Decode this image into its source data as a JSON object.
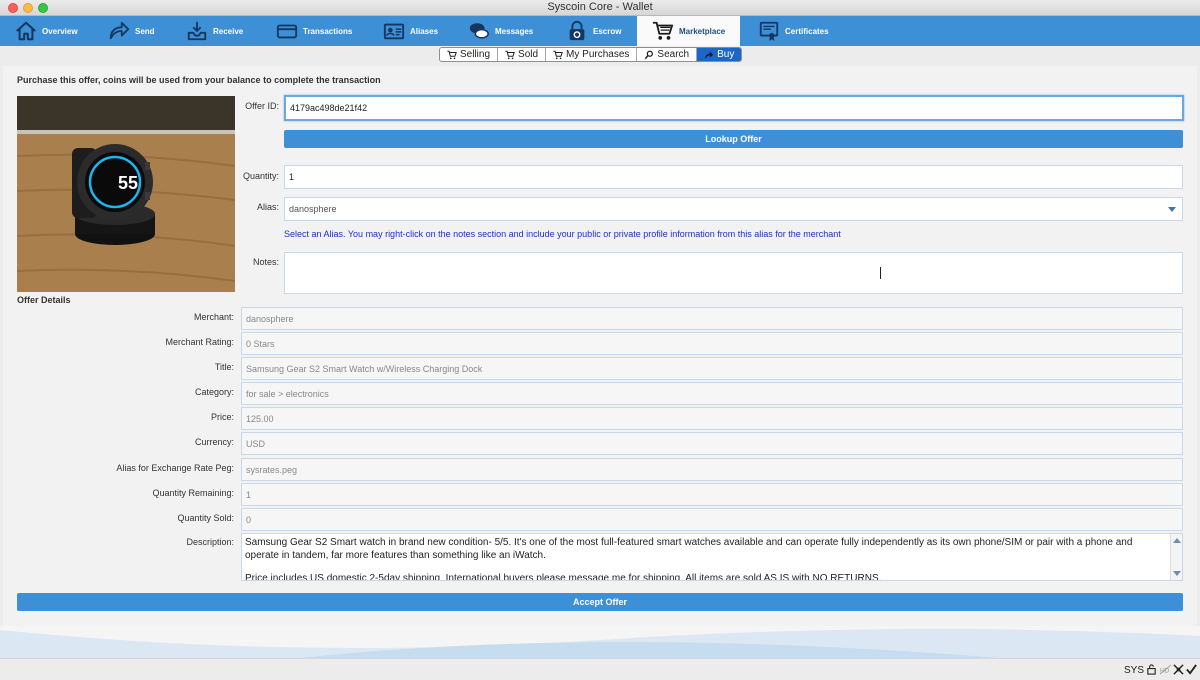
{
  "window": {
    "title": "Syscoin Core - Wallet"
  },
  "toolbar": {
    "items": [
      {
        "label": "Overview",
        "icon": "home-icon"
      },
      {
        "label": "Send",
        "icon": "send-arrow-icon"
      },
      {
        "label": "Receive",
        "icon": "receive-inbox-icon"
      },
      {
        "label": "Transactions",
        "icon": "card-icon"
      },
      {
        "label": "Aliases",
        "icon": "id-card-icon"
      },
      {
        "label": "Messages",
        "icon": "chat-bubbles-icon"
      },
      {
        "label": "Escrow",
        "icon": "escrow-lock-icon"
      },
      {
        "label": "Marketplace",
        "icon": "cart-icon"
      },
      {
        "label": "Certificates",
        "icon": "certificate-icon"
      }
    ],
    "active": "Marketplace"
  },
  "subtabs": {
    "items": [
      {
        "label": "Selling",
        "icon": "cart-icon"
      },
      {
        "label": "Sold",
        "icon": "cart-icon"
      },
      {
        "label": "My Purchases",
        "icon": "cart-icon"
      },
      {
        "label": "Search",
        "icon": "search-icon"
      },
      {
        "label": "Buy",
        "icon": "buy-arrow-icon"
      }
    ],
    "active": "Buy"
  },
  "buy": {
    "headline": "Purchase this offer, coins will be used from your balance to complete the transaction",
    "offer_id_label": "Offer ID:",
    "offer_id": "4179ac498de21f42",
    "lookup_button": "Lookup Offer",
    "quantity_label": "Quantity:",
    "quantity": "1",
    "alias_label": "Alias:",
    "alias": "danosphere",
    "alias_hint": "Select an Alias. You may right-click on the notes section and include your public or private profile information from this alias for the merchant",
    "notes_label": "Notes:",
    "notes": ""
  },
  "offer_details": {
    "section_title": "Offer Details",
    "merchant_label": "Merchant:",
    "merchant": "danosphere",
    "rating_label": "Merchant Rating:",
    "rating": "0 Stars",
    "title_label": "Title:",
    "title": "Samsung Gear S2 Smart Watch w/Wireless Charging Dock",
    "category_label": "Category:",
    "category": "for sale > electronics",
    "price_label": "Price:",
    "price": "125.00",
    "currency_label": "Currency:",
    "currency": "USD",
    "peg_label": "Alias for Exchange Rate Peg:",
    "peg": "sysrates.peg",
    "qty_remaining_label": "Quantity Remaining:",
    "qty_remaining": "1",
    "qty_sold_label": "Quantity Sold:",
    "qty_sold": "0",
    "description_label": "Description:",
    "description_p1": "Samsung Gear S2 Smart watch in brand new condition- 5/5. It's one of the most full-featured smart watches available and can operate fully independently as its own phone/SIM or pair with a phone and operate in tandem, far more features than something like an iWatch.",
    "description_p2": "Price includes US domestic 2-5day shipping. International buyers please message me for shipping. All items are sold AS IS with NO RETURNS."
  },
  "accept_button": "Accept Offer",
  "photo_watch_time": "55",
  "statusbar": {
    "unit": "SYS"
  },
  "colors": {
    "toolbar": "#3d8fd6",
    "button": "#3d8fd6",
    "hint_text": "#1d2fd0",
    "active_subtab": "#1a66c9"
  }
}
